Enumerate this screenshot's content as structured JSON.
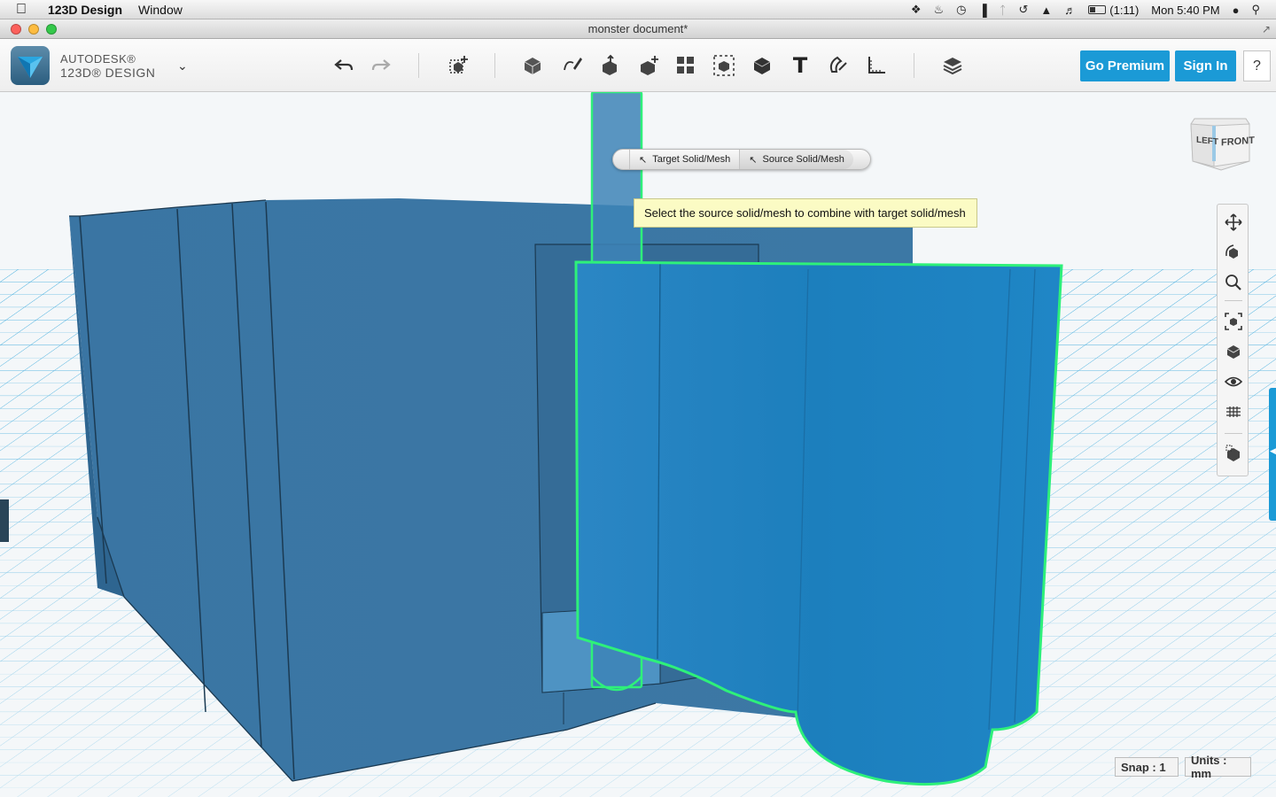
{
  "menubar": {
    "app_name": "123D Design",
    "menus": [
      "Window"
    ],
    "battery": "(1:11)",
    "clock": "Mon 5:40 PM"
  },
  "window": {
    "title": "monster document*"
  },
  "brand": {
    "line1": "AUTODESK®",
    "line2": "123D® DESIGN"
  },
  "toolbar": {
    "go_premium": "Go Premium",
    "sign_in": "Sign In",
    "help": "?",
    "text_tool": "T",
    "icons": [
      "undo-icon",
      "redo-icon",
      "transform-icon",
      "primitives-icon",
      "sketch-icon",
      "construct-icon",
      "modify-icon",
      "pattern-icon",
      "grouping-icon",
      "combine-icon",
      "text-icon",
      "snap-icon",
      "measure-icon",
      "material-icon"
    ]
  },
  "selection": {
    "target": "Target Solid/Mesh",
    "source": "Source Solid/Mesh",
    "hint": "Select the source solid/mesh to combine with target solid/mesh"
  },
  "viewcube": {
    "left": "LEFT",
    "front": "FRONT"
  },
  "status": {
    "snap": "Snap : 1",
    "units": "Units : mm"
  },
  "colors": {
    "accent": "#1b9ad6",
    "grid": "#34a6d8",
    "solid_dark": "#3c78a5",
    "solid_light": "#1e80bd",
    "selection": "#2ef07a",
    "hint_bg": "#fbfbc4"
  }
}
